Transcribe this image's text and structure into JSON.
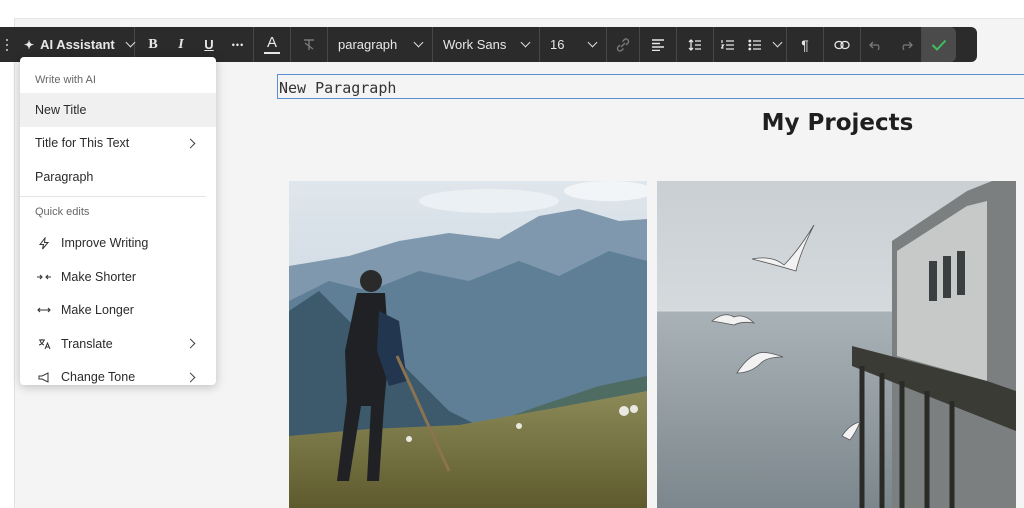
{
  "toolbar": {
    "ai_button_label": "AI Assistant",
    "bold_label": "B",
    "italic_label": "I",
    "underline_label": "U",
    "more_label": "•••",
    "text_color_label": "A",
    "block_type": "paragraph",
    "font_family": "Work Sans",
    "font_size": "16",
    "accent_color": "#3fbf5f"
  },
  "menu": {
    "section_write": "Write with AI",
    "items_write": [
      {
        "label": "New Title",
        "has_submenu": false
      },
      {
        "label": "Title for This Text",
        "has_submenu": true
      },
      {
        "label": "Paragraph",
        "has_submenu": false
      }
    ],
    "section_quick": "Quick edits",
    "items_quick": [
      {
        "label": "Improve Writing",
        "icon": "lightning-icon",
        "has_submenu": false
      },
      {
        "label": "Make Shorter",
        "icon": "shrink-icon",
        "has_submenu": false
      },
      {
        "label": "Make Longer",
        "icon": "expand-icon",
        "has_submenu": false
      },
      {
        "label": "Translate",
        "icon": "translate-icon",
        "has_submenu": true
      },
      {
        "label": "Change Tone",
        "icon": "megaphone-icon",
        "has_submenu": true
      }
    ]
  },
  "content": {
    "paragraph_text": "New Paragraph",
    "heading": "My Projects"
  }
}
